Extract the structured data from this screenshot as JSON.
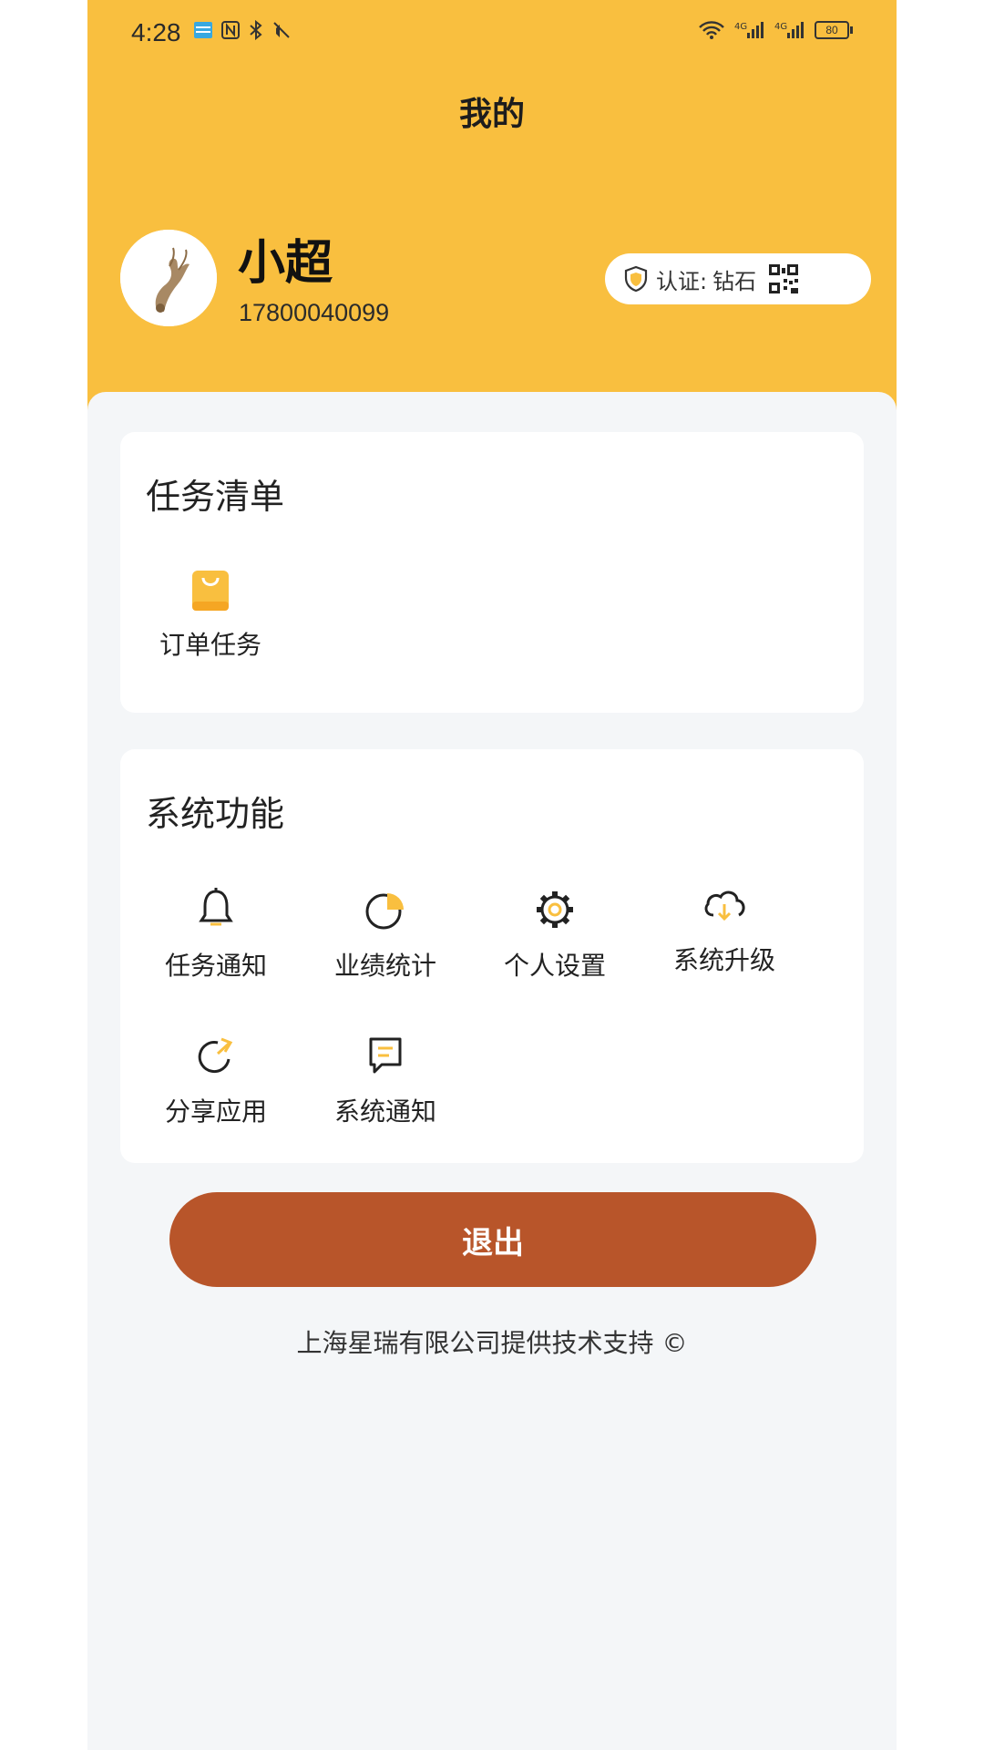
{
  "status_bar": {
    "time": "4:28",
    "battery": "80"
  },
  "header": {
    "title": "我的"
  },
  "user": {
    "name": "小超",
    "phone": "17800040099",
    "cert_label": "认证:",
    "cert_value": "钻石"
  },
  "tasks": {
    "title": "任务清单",
    "items": [
      {
        "label": "订单任务",
        "icon": "shopping-bag-icon"
      }
    ]
  },
  "system": {
    "title": "系统功能",
    "items": [
      {
        "label": "任务通知",
        "icon": "bell-icon"
      },
      {
        "label": "业绩统计",
        "icon": "pie-chart-icon"
      },
      {
        "label": "个人设置",
        "icon": "gear-icon"
      },
      {
        "label": "系统升级",
        "icon": "cloud-download-icon"
      },
      {
        "label": "分享应用",
        "icon": "share-icon"
      },
      {
        "label": "系统通知",
        "icon": "message-icon"
      }
    ]
  },
  "logout_label": "退出",
  "footer": "上海星瑞有限公司提供技术支持 ©",
  "colors": {
    "header_bg": "#f9bf3f",
    "accent": "#f9bf3f",
    "logout_bg": "#b8552a"
  }
}
